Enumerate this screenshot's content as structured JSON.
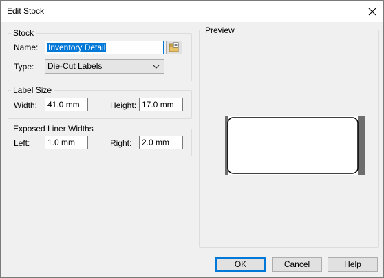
{
  "window": {
    "title": "Edit Stock",
    "close_icon": "close-icon"
  },
  "stock": {
    "legend": "Stock",
    "name_label": "Name:",
    "name_value": "Inventory Detail",
    "browse_icon": "folder-browse-icon",
    "type_label": "Type:",
    "type_value": "Die-Cut Labels"
  },
  "label_size": {
    "legend": "Label Size",
    "width_label": "Width:",
    "width_value": "41.0 mm",
    "height_label": "Height:",
    "height_value": "17.0 mm"
  },
  "liner": {
    "legend": "Exposed Liner Widths",
    "left_label": "Left:",
    "left_value": "1.0 mm",
    "right_label": "Right:",
    "right_value": "2.0 mm"
  },
  "preview": {
    "legend": "Preview"
  },
  "buttons": {
    "ok": "OK",
    "cancel": "Cancel",
    "help": "Help"
  },
  "colors": {
    "accent": "#0078d7",
    "liner": "#6d6d6d"
  }
}
